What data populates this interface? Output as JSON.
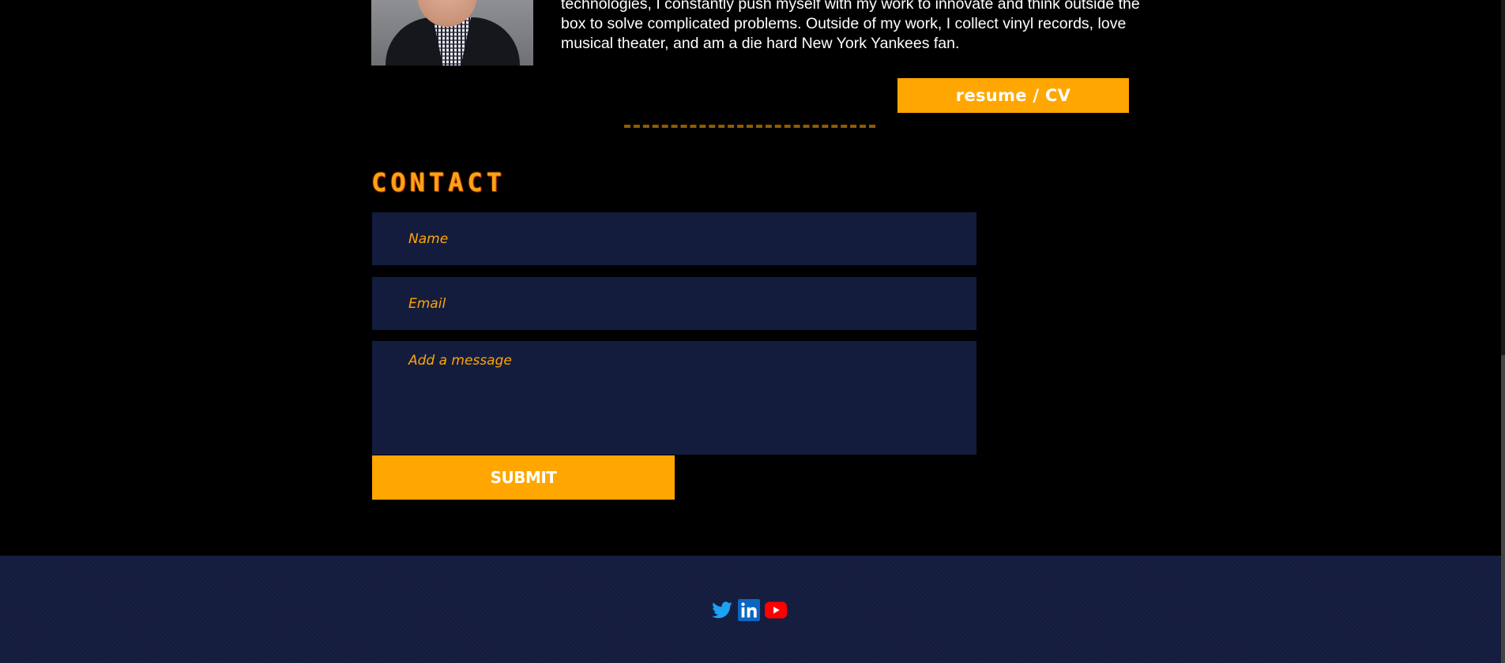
{
  "about": {
    "bio_lines": [
      "technologies, I constantly push myself with my work to innovate and think outside the",
      "box to solve complicated problems. Outside of my work, I collect vinyl records, love",
      "musical theater, and am a die hard New York Yankees fan."
    ],
    "resume_label": "resume / CV"
  },
  "contact": {
    "title": "CONTACT",
    "name_placeholder": "Name",
    "email_placeholder": "Email",
    "message_placeholder": "Add a message",
    "submit_label": "SUBMIT"
  },
  "footer": {
    "social": [
      {
        "icon": "twitter-icon",
        "color": "#1da1f2"
      },
      {
        "icon": "linkedin-icon",
        "color": "#0a66c2"
      },
      {
        "icon": "youtube-icon",
        "color": "#ff0000"
      }
    ]
  },
  "colors": {
    "accent": "#ffa600",
    "background": "#000000",
    "panel": "#141c3e"
  }
}
